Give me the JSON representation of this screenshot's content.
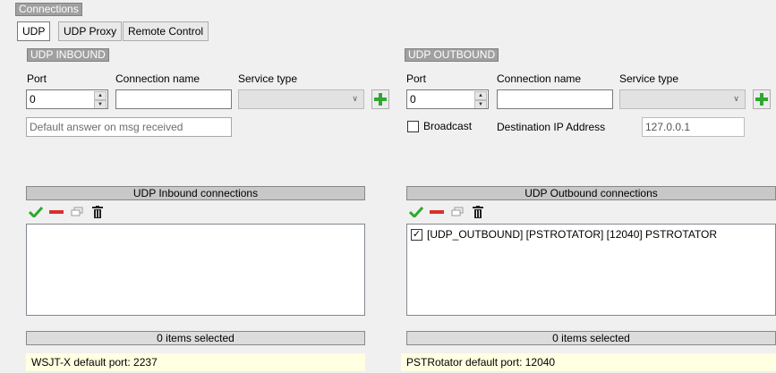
{
  "connections_label": "Connections",
  "tabs": [
    {
      "label": "UDP",
      "active": true
    },
    {
      "label": "UDP Proxy",
      "active": false
    },
    {
      "label": "Remote Control",
      "active": false
    }
  ],
  "inbound": {
    "group_label": "UDP INBOUND",
    "port_label": "Port",
    "port_value": "0",
    "conn_name_label": "Connection name",
    "conn_name_value": "",
    "service_type_label": "Service type",
    "service_type_value": "",
    "default_answer_placeholder": "Default answer on msg received",
    "connections_header": "UDP Inbound connections",
    "items": [],
    "status": "0 items selected",
    "info": "WSJT-X default port: 2237"
  },
  "outbound": {
    "group_label": "UDP OUTBOUND",
    "port_label": "Port",
    "port_value": "0",
    "conn_name_label": "Connection name",
    "conn_name_value": "",
    "service_type_label": "Service type",
    "service_type_value": "",
    "broadcast_label": "Broadcast",
    "broadcast_checked": false,
    "dest_ip_label": "Destination IP Address",
    "dest_ip_value": "127.0.0.1",
    "connections_header": "UDP Outbound connections",
    "items": [
      {
        "text": "[UDP_OUTBOUND] [PSTROTATOR] [12040] PSTROTATOR",
        "checked": true
      }
    ],
    "status": "0 items selected",
    "info": "PSTRotator default port: 12040"
  },
  "toolbar_icons": [
    "check-icon",
    "minus-icon",
    "window-icon",
    "trash-icon"
  ],
  "colors": {
    "accent_green": "#2fa82f",
    "delete_red": "#d9312a",
    "info_background": "#ffffe1",
    "group_label_bg": "#a0a0a0"
  }
}
